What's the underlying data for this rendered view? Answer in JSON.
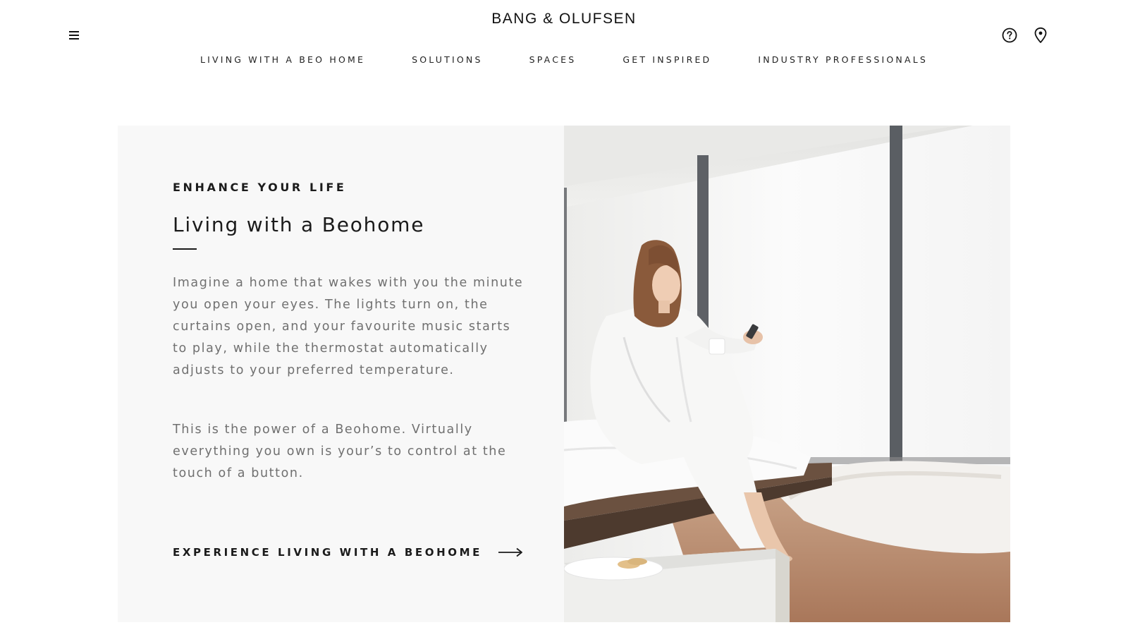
{
  "brand": {
    "logo_text": "BANG & OLUFSEN"
  },
  "header": {
    "menu_icon": "hamburger-menu-icon",
    "help_icon": "help-question-icon",
    "location_icon": "store-locator-pin-icon"
  },
  "nav": {
    "items": [
      {
        "label": "LIVING WITH A BEO HOME"
      },
      {
        "label": "SOLUTIONS"
      },
      {
        "label": "SPACES"
      },
      {
        "label": "GET INSPIRED"
      },
      {
        "label": "INDUSTRY PROFESSIONALS"
      }
    ]
  },
  "hero": {
    "eyebrow": "ENHANCE YOUR LIFE",
    "title": "Living with a Beohome",
    "paragraph_1": "Imagine a home that wakes with you the minute you open your eyes. The lights turn on, the curtains open, and your favourite music starts to play, while the thermostat automatically adjusts to your preferred temperature.",
    "paragraph_2": "This is the power of a Beohome. Virtually everything you own is your’s to control at the touch of a button.",
    "cta_label": "EXPERIENCE LIVING WITH A BEOHOME",
    "cta_icon": "arrow-right-icon",
    "image": "woman-in-bathrobe-with-phone-photo"
  },
  "colors": {
    "text_dark": "#1b1b1b",
    "text_muted": "#707070",
    "panel_bg": "#f8f8f8",
    "page_bg": "#ffffff"
  }
}
